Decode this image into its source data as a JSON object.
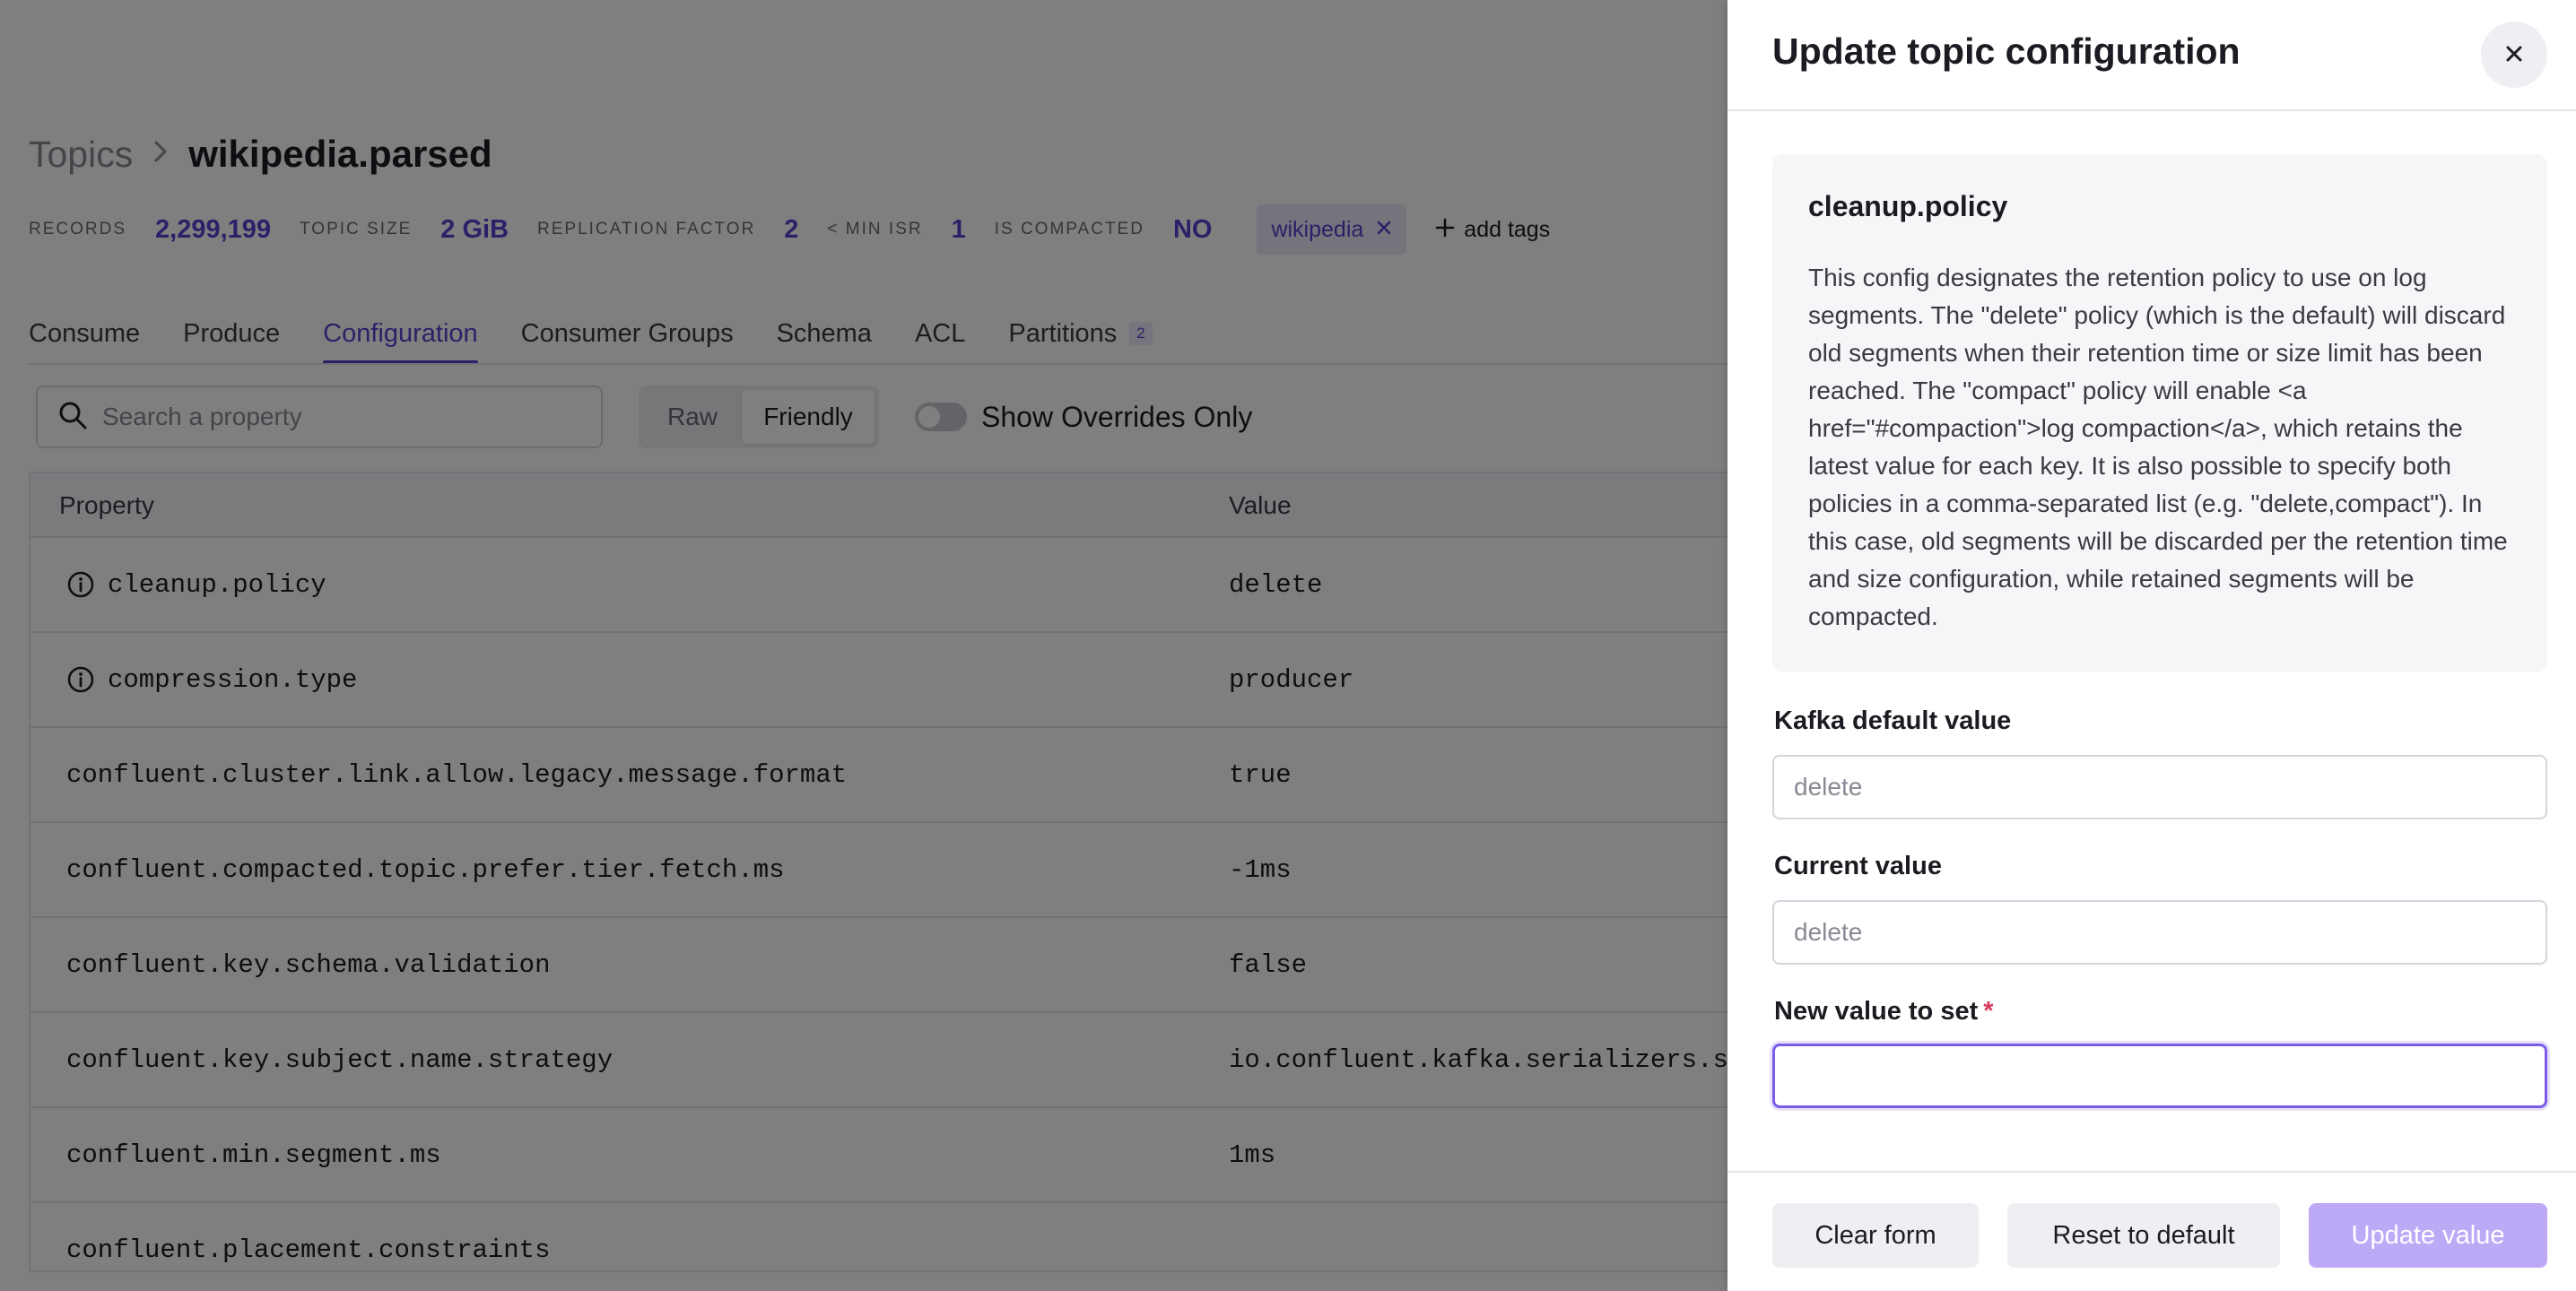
{
  "breadcrumb": {
    "root": "Topics",
    "separator": "›",
    "current": "wikipedia.parsed"
  },
  "stats": [
    {
      "label": "RECORDS",
      "value": "2,299,199"
    },
    {
      "label": "TOPIC SIZE",
      "value": "2 GiB"
    },
    {
      "label": "REPLICATION FACTOR",
      "value": "2"
    },
    {
      "label": "< MIN ISR",
      "value": "1"
    },
    {
      "label": "IS COMPACTED",
      "value": "NO"
    }
  ],
  "tags": {
    "items": [
      "wikipedia"
    ],
    "add_label": "add tags"
  },
  "tabs": [
    {
      "label": "Consume"
    },
    {
      "label": "Produce"
    },
    {
      "label": "Configuration",
      "active": true
    },
    {
      "label": "Consumer Groups"
    },
    {
      "label": "Schema"
    },
    {
      "label": "ACL"
    },
    {
      "label": "Partitions",
      "badge": "2"
    }
  ],
  "toolbar": {
    "search_placeholder": "Search a property",
    "view_modes": [
      "Raw",
      "Friendly"
    ],
    "selected_view": "Friendly",
    "overrides_toggle_label": "Show Overrides Only",
    "overrides_toggle_on": false
  },
  "table": {
    "columns": [
      "Property",
      "Value"
    ],
    "rows": [
      {
        "property": "cleanup.policy",
        "value": "delete",
        "info": true
      },
      {
        "property": "compression.type",
        "value": "producer",
        "info": true
      },
      {
        "property": "confluent.cluster.link.allow.legacy.message.format",
        "value": "true",
        "info": false
      },
      {
        "property": "confluent.compacted.topic.prefer.tier.fetch.ms",
        "value": "-1ms",
        "info": false
      },
      {
        "property": "confluent.key.schema.validation",
        "value": "false",
        "info": false
      },
      {
        "property": "confluent.key.subject.name.strategy",
        "value": "io.confluent.kafka.serializers.su",
        "info": false
      },
      {
        "property": "confluent.min.segment.ms",
        "value": "1ms",
        "info": false
      },
      {
        "property": "confluent.placement.constraints",
        "value": "",
        "info": false
      }
    ]
  },
  "drawer": {
    "title": "Update topic configuration",
    "config_name": "cleanup.policy",
    "description": "This config designates the retention policy to use on log segments. The \"delete\" policy (which is the default) will discard old segments when their retention time or size limit has been reached. The \"compact\" policy will enable <a href=\"#compaction\">log compaction</a>, which retains the latest value for each key. It is also possible to specify both policies in a comma-separated list (e.g. \"delete,compact\"). In this case, old segments will be discarded per the retention time and size configuration, while retained segments will be compacted.",
    "default_label": "Kafka default value",
    "default_value": "delete",
    "current_label": "Current value",
    "current_value": "delete",
    "new_label": "New value to set",
    "required_mark": "*",
    "new_value": "",
    "buttons": {
      "clear": "Clear form",
      "reset": "Reset to default",
      "update": "Update value"
    }
  },
  "colors": {
    "accent": "#5b3fd1",
    "primary_disabled": "#bcaaf7",
    "overlay": "rgba(0,0,0,0.5)"
  }
}
